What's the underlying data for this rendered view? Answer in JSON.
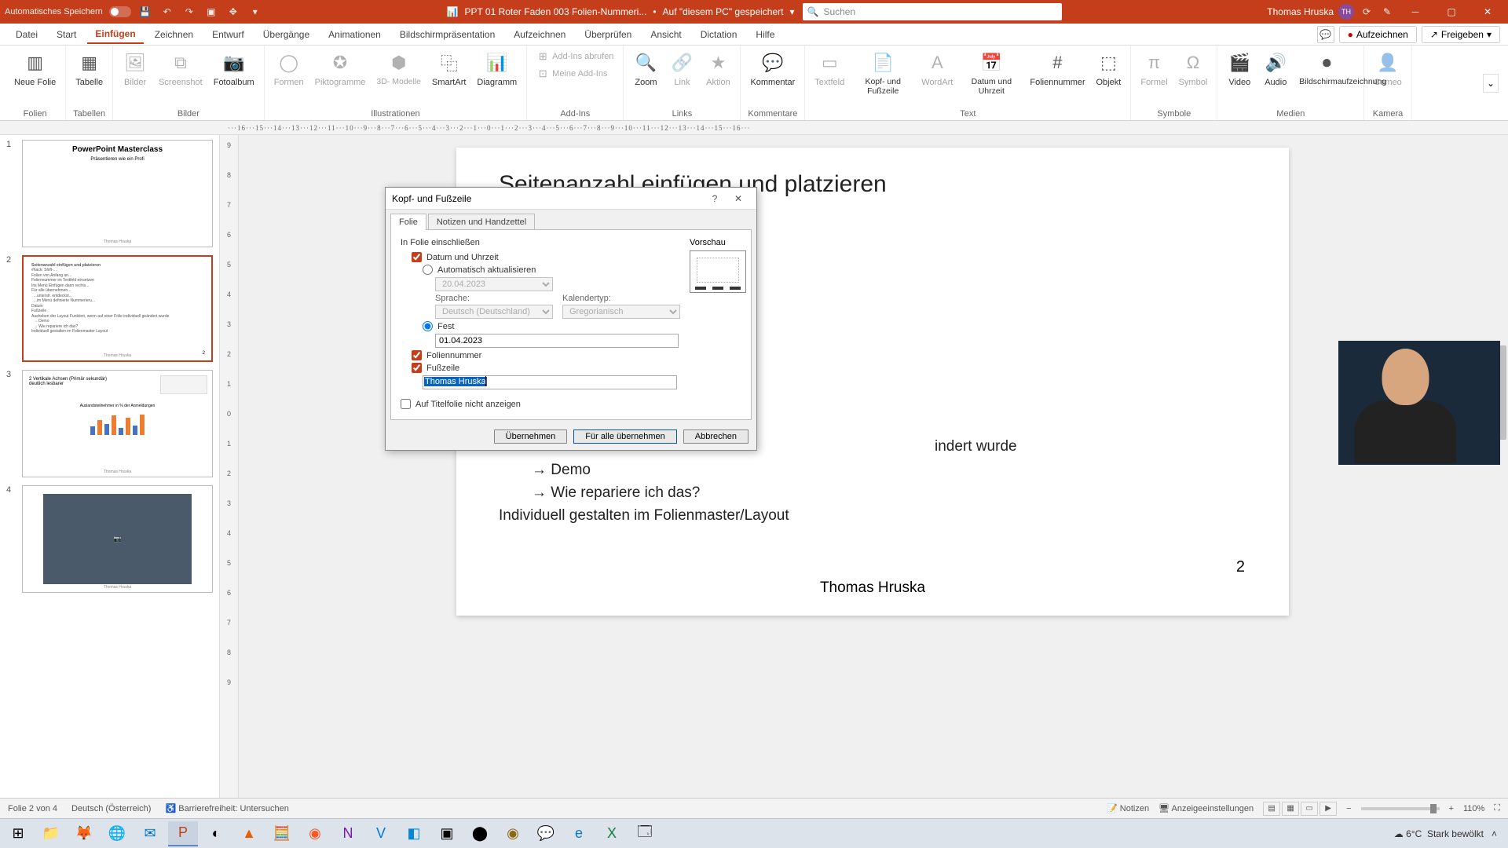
{
  "titlebar": {
    "autosave_label": "Automatisches Speichern",
    "filename": "PPT 01 Roter Faden 003 Folien-Nummeri...",
    "saved_status": "Auf \"diesem PC\" gespeichert",
    "search_placeholder": "Suchen",
    "user_name": "Thomas Hruska",
    "user_initials": "TH"
  },
  "ribbon_tabs": [
    "Datei",
    "Start",
    "Einfügen",
    "Zeichnen",
    "Entwurf",
    "Übergänge",
    "Animationen",
    "Bildschirmpräsentation",
    "Aufzeichnen",
    "Überprüfen",
    "Ansicht",
    "Dictation",
    "Hilfe"
  ],
  "ribbon_active_tab": "Einfügen",
  "ribbon_right": {
    "record": "Aufzeichnen",
    "share": "Freigeben"
  },
  "ribbon": {
    "folien": {
      "new_slide": "Neue\nFolie",
      "group": "Folien"
    },
    "tabellen": {
      "table": "Tabelle",
      "group": "Tabellen"
    },
    "bilder": {
      "pic": "Bilder",
      "screenshot": "Screenshot",
      "album": "Fotoalbum",
      "group": "Bilder"
    },
    "illustr": {
      "shapes": "Formen",
      "picto": "Piktogramme",
      "three_d": "3D-\nModelle",
      "smartart": "SmartArt",
      "chart": "Diagramm",
      "group": "Illustrationen"
    },
    "addins": {
      "get": "Add-Ins abrufen",
      "mine": "Meine Add-Ins",
      "group": "Add-Ins"
    },
    "links": {
      "zoom": "Zoom",
      "link": "Link",
      "action": "Aktion",
      "group": "Links"
    },
    "komment": {
      "comment": "Kommentar",
      "group": "Kommentare"
    },
    "text": {
      "textbox": "Textfeld",
      "header": "Kopf- und\nFußzeile",
      "wordart": "WordArt",
      "datetime": "Datum und\nUhrzeit",
      "slidenum": "Foliennummer",
      "object": "Objekt",
      "group": "Text"
    },
    "symbole": {
      "formula": "Formel",
      "symbol": "Symbol",
      "group": "Symbole"
    },
    "medien": {
      "video": "Video",
      "audio": "Audio",
      "screenrec": "Bildschirmaufzeichnung",
      "group": "Medien"
    },
    "kamera": {
      "cameo": "Cameo",
      "group": "Kamera"
    }
  },
  "thumbnails": [
    {
      "num": "1",
      "title": "PowerPoint Masterclass",
      "sub": "Präsentieren wie ein Profi",
      "footer": "Thomas Hruska"
    },
    {
      "num": "2",
      "title": "Seitenanzahl einfügen und platzieren",
      "footer": "Thomas Hruska",
      "active": true
    },
    {
      "num": "3",
      "title": "",
      "footer": "Thomas Hruska"
    },
    {
      "num": "4",
      "title": "",
      "footer": "Thomas Hruska"
    }
  ],
  "slide": {
    "title": "Seitenanzahl einfügen und platzieren",
    "l1": "#hack: Sl",
    "l2": "Folien vo",
    "l3": "Foliennu",
    "l4": "Ins Menü",
    "l5": "Für alle ü",
    "l6": "Datum",
    "l7": "Fußzeile",
    "l8_left": "Aushebe",
    "l8_right": "indert wurde",
    "l9": "Demo",
    "l10": "Wie repariere ich das?",
    "l11": "Individuell gestalten im Folienmaster/Layout",
    "footer": "Thomas Hruska",
    "page": "2"
  },
  "dialog": {
    "title": "Kopf- und Fußzeile",
    "tabs": [
      "Folie",
      "Notizen und Handzettel"
    ],
    "section": "In Folie einschließen",
    "cb_datetime": "Datum und Uhrzeit",
    "rb_auto": "Automatisch aktualisieren",
    "auto_date": "20.04.2023",
    "lang_label": "Sprache:",
    "lang_value": "Deutsch (Deutschland)",
    "cal_label": "Kalendertyp:",
    "cal_value": "Gregorianisch",
    "rb_fixed": "Fest",
    "fixed_value": "01.04.2023",
    "cb_slidenum": "Foliennummer",
    "cb_footer": "Fußzeile",
    "footer_value": "Thomas Hruska",
    "cb_title_hide": "Auf Titelfolie nicht anzeigen",
    "preview": "Vorschau",
    "btn_apply": "Übernehmen",
    "btn_apply_all": "Für alle übernehmen",
    "btn_cancel": "Abbrechen"
  },
  "statusbar": {
    "slide_info": "Folie 2 von 4",
    "language": "Deutsch (Österreich)",
    "accessibility": "Barrierefreiheit: Untersuchen",
    "notes": "Notizen",
    "display": "Anzeigeeinstellungen",
    "zoom": "110%"
  },
  "taskbar": {
    "weather_temp": "6°C",
    "weather_text": "Stark bewölkt"
  },
  "ruler_marks": "···16···15···14···13···12···11···10···9···8···7···6···5···4···3···2···1···0···1···2···3···4···5···6···7···8···9···10···11···12···13···14···15···16···"
}
